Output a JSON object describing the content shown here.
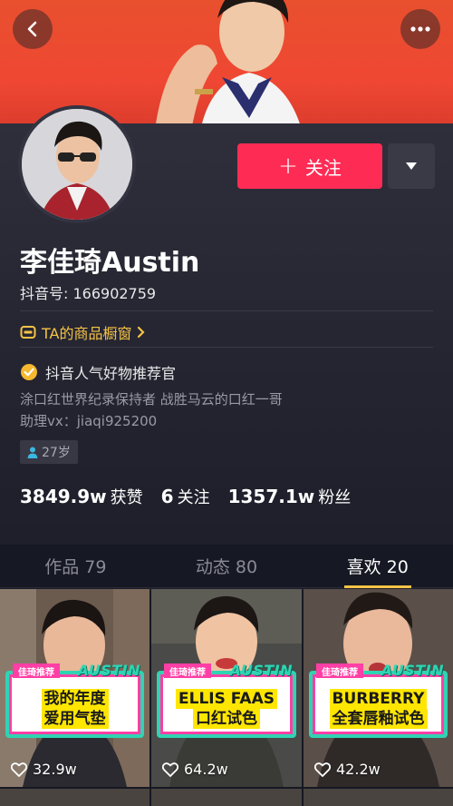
{
  "header": {
    "back_icon": "chevron-left-icon",
    "more_icon": "more-dots-icon"
  },
  "profile": {
    "name": "李佳琦Austin",
    "douyin_id": "抖音号: 166902759",
    "follow_label": "关注",
    "shop_label": "TA的商品橱窗",
    "verify_label": "抖音人气好物推荐官",
    "bio_line1": "涂口红世界纪录保持者 战胜马云的口红一哥",
    "bio_line2": "助理vx：jiaqi925200",
    "age": "27岁"
  },
  "stats": [
    {
      "num": "3849.9w",
      "label": "获赞"
    },
    {
      "num": "6",
      "label": "关注"
    },
    {
      "num": "1357.1w",
      "label": "粉丝"
    }
  ],
  "tabs": [
    {
      "label": "作品 79"
    },
    {
      "label": "动态 80"
    },
    {
      "label": "喜欢 20"
    }
  ],
  "videos": [
    {
      "tag": "佳琦推荐",
      "brand": "AUSTIN",
      "line1": "我的年度",
      "line2": "爱用气垫",
      "likes": "32.9w"
    },
    {
      "tag": "佳琦推荐",
      "brand": "AUSTIN",
      "line1": "ELLIS FAAS",
      "line2": "口红试色",
      "likes": "64.2w"
    },
    {
      "tag": "佳琦推荐",
      "brand": "AUSTIN",
      "line1": "BURBERRY",
      "line2": "全套唇釉试色",
      "likes": "42.2w"
    }
  ],
  "colors": {
    "accent": "#fe2c55",
    "gold": "#f5c346",
    "background": "#161823",
    "banner_teal": "#2fd4b3",
    "banner_pink": "#ff3fa5"
  }
}
